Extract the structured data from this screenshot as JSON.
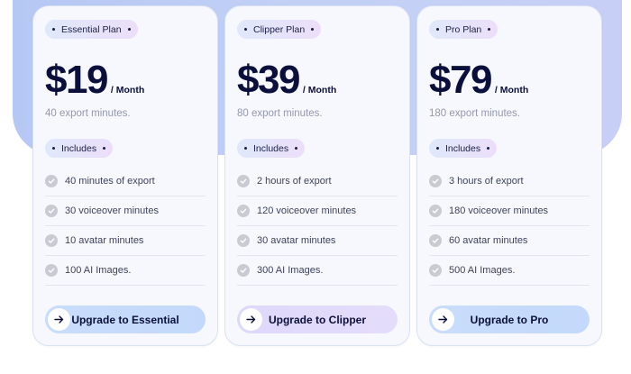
{
  "colors": {
    "band": "#bccbf5",
    "card_bg": "#f6f8fd",
    "price": "#0b0f3b",
    "muted": "#9498ae",
    "check": "#c9cbd3",
    "cta_blue": "#c9dcfb",
    "cta_violet": "#ded8fb"
  },
  "plans": [
    {
      "name": "Essential Plan",
      "price": "$19",
      "period": "/ Month",
      "subtitle": "40 export minutes.",
      "includes_label": "Includes",
      "features": [
        "40 minutes of export",
        "30 voiceover minutes",
        "10 avatar minutes",
        "100 AI Images."
      ],
      "cta": "Upgrade to Essential",
      "cta_icon": "arrow-right-icon"
    },
    {
      "name": "Clipper Plan",
      "price": "$39",
      "period": "/ Month",
      "subtitle": "80 export minutes.",
      "includes_label": "Includes",
      "features": [
        "2 hours of export",
        "120 voiceover minutes",
        "30 avatar minutes",
        "300 AI Images."
      ],
      "cta": "Upgrade to Clipper",
      "cta_icon": "arrow-right-icon"
    },
    {
      "name": "Pro Plan",
      "price": "$79",
      "period": "/ Month",
      "subtitle": "180 export minutes.",
      "includes_label": "Includes",
      "features": [
        "3 hours of export",
        "180 voiceover minutes",
        "60 avatar minutes",
        "500 AI Images."
      ],
      "cta": "Upgrade to Pro",
      "cta_icon": "arrow-right-icon"
    }
  ]
}
